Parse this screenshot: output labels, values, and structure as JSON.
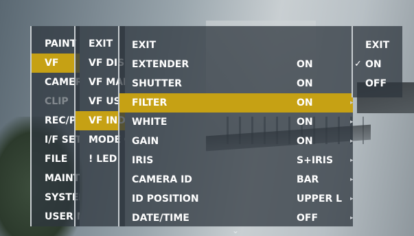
{
  "menu_l1": [
    "PAINT",
    "VF",
    "CAMERA",
    "CLIP",
    "REC/PLAY",
    "I/F SETUP",
    "FILE",
    "MAINTENANCE",
    "SYSTEM",
    "USER MENU SEL"
  ],
  "menu_l2": [
    "EXIT",
    "VF DISPLAY",
    "VF MARKER",
    "VF USER",
    "VF INDICATOR",
    "MODE CHECK",
    "! LED"
  ],
  "menu_l3": [
    {
      "label": "EXIT",
      "value": ""
    },
    {
      "label": "EXTENDER",
      "value": "ON"
    },
    {
      "label": "SHUTTER",
      "value": "ON"
    },
    {
      "label": "FILTER",
      "value": "ON"
    },
    {
      "label": "WHITE",
      "value": "ON"
    },
    {
      "label": "GAIN",
      "value": "ON"
    },
    {
      "label": "IRIS",
      "value": "S+IRIS"
    },
    {
      "label": "CAMERA ID",
      "value": "BAR"
    },
    {
      "label": "ID POSITION",
      "value": "UPPER L"
    },
    {
      "label": "DATE/TIME",
      "value": "OFF"
    }
  ],
  "menu_l4": [
    "EXIT",
    "ON",
    "OFF"
  ],
  "check_mark": "✓",
  "submenu_arrow": "▸",
  "more_indicator": "⌄",
  "highlight_color": "#c6a114"
}
